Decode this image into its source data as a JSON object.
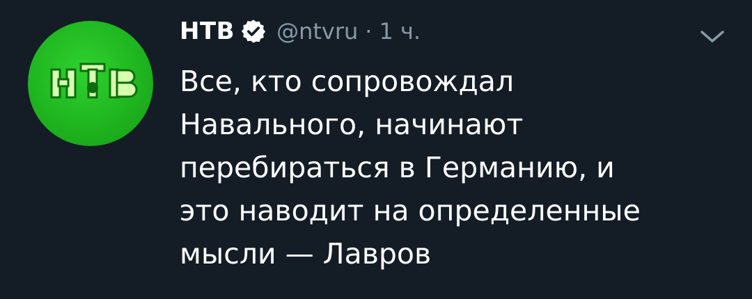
{
  "tweet": {
    "author_name": "НТВ",
    "handle": "@ntvru",
    "separator": "·",
    "time": "1 ч.",
    "text_lines": [
      "Все, кто сопровождал",
      "Навального, начинают",
      "перебираться в Германию, и",
      "это наводит на определенные",
      "мысли — Лавров"
    ]
  },
  "icons": {
    "avatar": "ntv-logo-avatar",
    "verified": "verified-badge-icon",
    "menu": "chevron-down-icon"
  },
  "colors": {
    "background": "#141d26",
    "text_primary": "#ffffff",
    "text_secondary": "#8899a6",
    "avatar_green": "#1fb51f"
  }
}
